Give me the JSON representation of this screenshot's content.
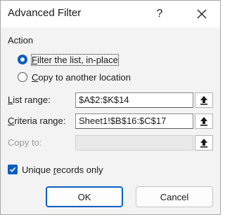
{
  "window": {
    "title": "Advanced Filter",
    "help_label": "?",
    "close_icon": "close-icon"
  },
  "action": {
    "group_label": "Action",
    "options": [
      {
        "pre": "",
        "key": "F",
        "post": "ilter the list, in-place",
        "selected": true
      },
      {
        "pre": "",
        "key": "C",
        "post": "opy to another location",
        "selected": false
      }
    ]
  },
  "fields": {
    "list_range": {
      "pre": "",
      "key": "L",
      "post": "ist range:",
      "value": "$A$2:$K$14"
    },
    "criteria_range": {
      "pre": "",
      "key": "C",
      "post": "riteria range:",
      "value": "Sheet1!$B$16:$C$17"
    },
    "copy_to": {
      "label": "Copy to:",
      "value": "",
      "disabled": true
    }
  },
  "unique": {
    "pre": "Unique ",
    "key": "r",
    "post": "ecords only",
    "checked": true
  },
  "buttons": {
    "ok": "OK",
    "cancel": "Cancel"
  },
  "colors": {
    "accent": "#0a5ec0",
    "dialog_bg": "#f3f3f3",
    "title_bg": "#ffffff"
  },
  "icons": {
    "pick": "collapse-dialog-icon",
    "check": "checkmark-icon"
  }
}
